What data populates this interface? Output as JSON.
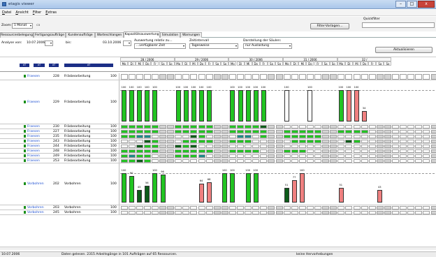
{
  "window": {
    "title": "etagis viewer",
    "min": "–",
    "max": "□",
    "close": "x"
  },
  "menu": [
    "Datei",
    "Ansicht",
    "Filter",
    "Extras"
  ],
  "toolbar": {
    "zoom_label": "Zoom:",
    "zoom_value": "1 Monat",
    "zoom_extra": "ca",
    "filter_button": "Filter-Vorlagen...",
    "quickfilter_label": "Quickfilter",
    "quickfilter_value": ""
  },
  "tabs": [
    {
      "label": "Ressourcenbelegung",
      "active": false
    },
    {
      "label": "Fertigungsaufträge",
      "active": false
    },
    {
      "label": "Kundenaufträge",
      "active": false
    },
    {
      "label": "Warteschlangen",
      "active": false
    },
    {
      "label": "Kapazitätsauswertung",
      "active": true
    },
    {
      "label": "Simulation",
      "active": false
    },
    {
      "label": "Warnungen",
      "active": false
    }
  ],
  "options": {
    "analysis_from_label": "Analyse von:",
    "analysis_from": "10.07.2006",
    "to_label": "bis:",
    "analysis_to": "03.10.2006",
    "relative_label": "Auswertung relativ zu...",
    "relative_value": "...verfügbarer Zeit",
    "interval_label": "Zeitintervall",
    "interval_value": "Tagesweise",
    "display_label": "Darstellung der Säulen:",
    "display_value": "nur Auslastung",
    "refresh_button": "Aktualisieren"
  },
  "columns": [
    "AT",
    "AT",
    "AT",
    "AT"
  ],
  "weeks": [
    "28 / 2006",
    "29 / 2006",
    "30 / 2006",
    "31 / 2006",
    "32 /"
  ],
  "days": [
    "Mo",
    "Di",
    "Mi",
    "Do",
    "Fr",
    "Sa",
    "So"
  ],
  "rows": [
    {
      "group": "Fraesen",
      "id": "228",
      "name": "Fräsbearbeitung",
      "pct": "100"
    },
    {
      "group": "Fraesen",
      "id": "229",
      "name": "Fräsbearbeitung",
      "pct": "100"
    },
    {
      "group": "Fraesen",
      "id": "230",
      "name": "Fräsbearbeitung",
      "pct": "100"
    },
    {
      "group": "Fraesen",
      "id": "227",
      "name": "Fräsbearbeitung",
      "pct": "100"
    },
    {
      "group": "Fraesen",
      "id": "235",
      "name": "Fräsbearbeitung",
      "pct": "100"
    },
    {
      "group": "Fraesen",
      "id": "243",
      "name": "Fräsbearbeitung",
      "pct": "100"
    },
    {
      "group": "Fraesen",
      "id": "244",
      "name": "Fräsbearbeitung",
      "pct": "100"
    },
    {
      "group": "Fraesen",
      "id": "248",
      "name": "Fräsbearbeitung",
      "pct": "100"
    },
    {
      "group": "Fraesen",
      "id": "249",
      "name": "Fräsbearbeitung",
      "pct": "100"
    },
    {
      "group": "Fraesen",
      "id": "253",
      "name": "Fräsbearbeitung",
      "pct": "100"
    },
    {
      "group": "Vorbohren",
      "id": "202",
      "name": "Vorbohren",
      "pct": "100"
    },
    {
      "group": "Vorbohren",
      "id": "203",
      "name": "Vorbohren",
      "pct": "100"
    },
    {
      "group": "Vorbohren",
      "id": "245",
      "name": "Vorbohren",
      "pct": "100"
    }
  ],
  "big_rows": {
    "r229": {
      "values": [
        100,
        100,
        100,
        100,
        100,
        100,
        100,
        null,
        null,
        null,
        null,
        null,
        null,
        100,
        100,
        100,
        100,
        100,
        100,
        null,
        null,
        null,
        null,
        null,
        100,
        100,
        100,
        34
      ],
      "colors": [
        "g",
        "g",
        "g",
        "g",
        "g",
        "g",
        "g",
        "",
        "",
        "",
        "",
        "",
        "",
        "g",
        "g",
        "g",
        "g",
        "g",
        "g",
        "",
        "",
        "",
        "",
        "",
        "g",
        "r",
        "r",
        "r"
      ],
      "labels": [
        "100",
        "100",
        "100",
        "100",
        "100",
        "100",
        "100",
        "100",
        "100",
        "100",
        "100",
        "100",
        "100",
        "100",
        "100",
        "100",
        "100",
        "100",
        "100",
        "34"
      ]
    },
    "r202": {
      "labels": [
        "100",
        "90",
        "43",
        "56",
        "100",
        "96",
        "64",
        "68",
        "100",
        "100",
        "100",
        "100",
        "51",
        "77",
        "100",
        "51",
        "43"
      ]
    }
  },
  "status": {
    "date": "10.07.2006",
    "message": "Daten gelesen. 2315 Arbeitsgänge in 101 Aufträgen auf 65 Ressourcen.",
    "hint": "keine Hervorhebungen"
  },
  "colors": {
    "green": "#22c422",
    "red": "#f08080",
    "dark_green": "#0d5c1a",
    "teal": "#1e8a8a",
    "blue_cell": "#2e6fa8",
    "header_blue": "#1b2e86"
  }
}
